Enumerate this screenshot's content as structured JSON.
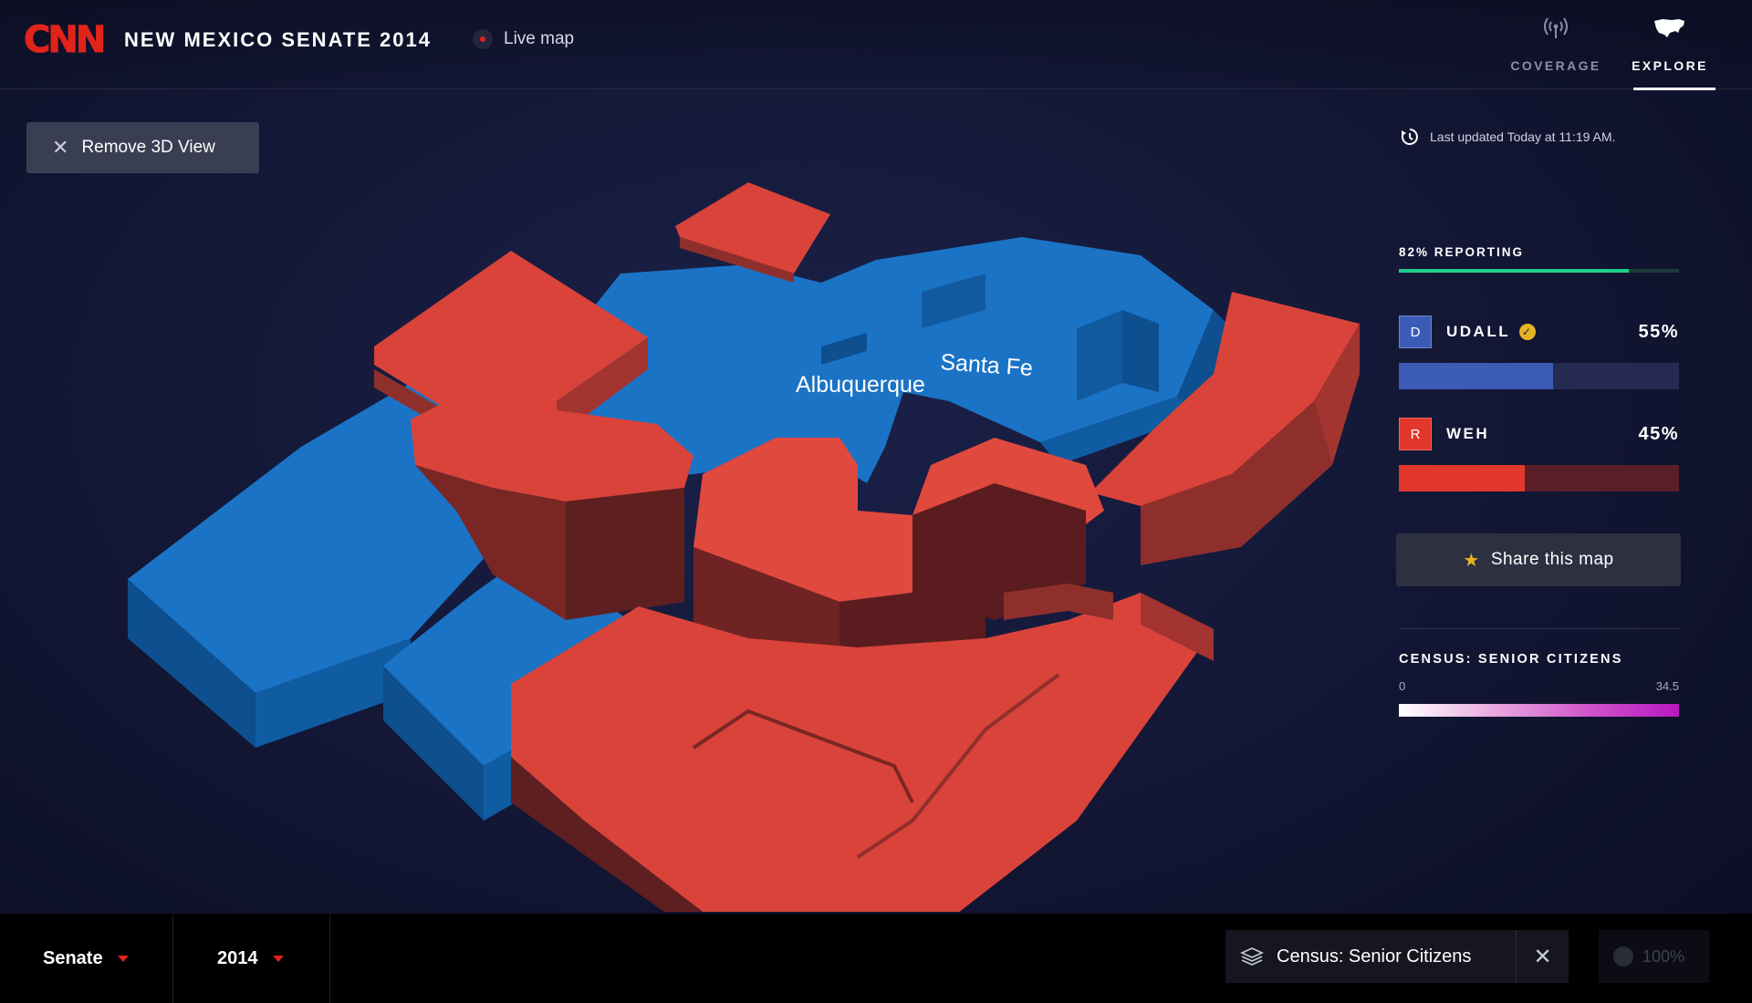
{
  "header": {
    "logo": "CNN",
    "title": "NEW MEXICO SENATE 2014",
    "live_label": "Live map",
    "tabs": [
      {
        "label": "COVERAGE",
        "icon": "broadcast-icon"
      },
      {
        "label": "EXPLORE",
        "icon": "us-map-icon"
      }
    ]
  },
  "controls": {
    "remove_3d": "Remove 3D View"
  },
  "map": {
    "cities": [
      "Albuquerque",
      "Santa Fe"
    ],
    "colors": {
      "democrat": "#1b73c6",
      "republican": "#d9433a"
    }
  },
  "panel": {
    "last_updated": "Last updated Today at 11:19 AM.",
    "reporting_label": "82% REPORTING",
    "reporting_fraction": 0.82,
    "candidates": [
      {
        "party": "D",
        "name": "UDALL",
        "winner": true,
        "pct_label": "55%",
        "share": 0.55,
        "color": "#3b5bb5",
        "track": "#242a52"
      },
      {
        "party": "R",
        "name": "WEH",
        "winner": false,
        "pct_label": "45%",
        "share": 0.45,
        "color": "#e2372b",
        "track": "#5a1e26"
      }
    ],
    "share_label": "Share this map",
    "census": {
      "title": "CENSUS: SENIOR CITIZENS",
      "min": "0",
      "max": "34.5"
    }
  },
  "bottom": {
    "race": "Senate",
    "year": "2014",
    "layer": "Census: Senior Citizens",
    "opacity": "100%"
  }
}
